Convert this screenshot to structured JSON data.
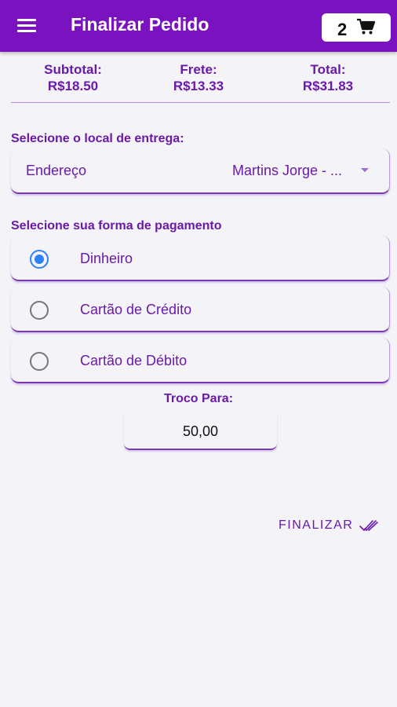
{
  "header": {
    "title": "Finalizar Pedido",
    "cart_count": "2",
    "menu_icon": "hamburger-menu-icon",
    "cart_icon": "shopping-cart-icon"
  },
  "totals": {
    "subtotal_label": "Subtotal:",
    "subtotal_value": "R$18.50",
    "frete_label": "Frete:",
    "frete_value": "R$13.33",
    "total_label": "Total:",
    "total_value": "R$31.83"
  },
  "delivery": {
    "section_label": "Selecione o local de entrega:",
    "field_label": "Endereço",
    "selected_value": "Martins Jorge - ..."
  },
  "payment": {
    "section_label": "Selecione sua forma de pagamento",
    "options": [
      {
        "label": "Dinheiro",
        "selected": true
      },
      {
        "label": "Cartão de Crédito",
        "selected": false
      },
      {
        "label": "Cartão de Débito",
        "selected": false
      }
    ]
  },
  "troco": {
    "label": "Troco Para:",
    "value": "50,00"
  },
  "actions": {
    "finalizar_label": "FINALIZAR",
    "finalizar_icon": "double-check-icon"
  },
  "colors": {
    "primary": "#7a12bf",
    "text_accent": "#6a1aa8",
    "radio_selected": "#2f80f5",
    "background": "#f3f3f8"
  }
}
